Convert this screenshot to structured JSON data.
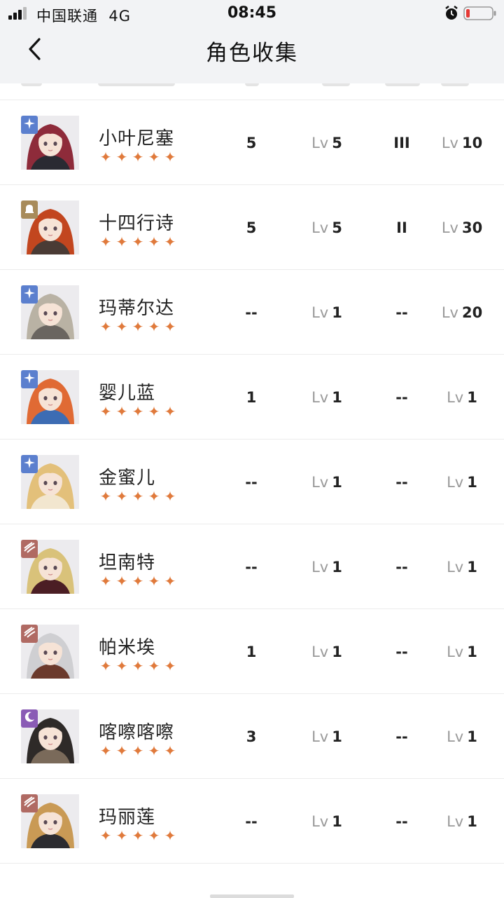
{
  "status": {
    "carrier": "中国联通",
    "network": "4G",
    "time": "08:45",
    "battery_color": "#e53935"
  },
  "nav": {
    "title": "角色收集"
  },
  "colors": {
    "star": "#e07a3c",
    "blue_badge": "#5b7fce",
    "gold_badge": "#a88b5a",
    "red_badge": "#b06a63",
    "purple_badge": "#8a5bb5"
  },
  "characters": [
    {
      "name": "小叶尼塞",
      "stars": "★★★★★",
      "badge": "star-icon",
      "badge_color": "#5b7fce",
      "col1": "5",
      "lv_label": "Lv",
      "col2": "5",
      "col3": "III",
      "col4": "10",
      "hair": "#8e2b3a",
      "coat": "#2a2a32"
    },
    {
      "name": "十四行诗",
      "stars": "★★★★★",
      "badge": "bell-icon",
      "badge_color": "#a88b5a",
      "col1": "5",
      "lv_label": "Lv",
      "col2": "5",
      "col3": "II",
      "col4": "30",
      "hair": "#c2461f",
      "coat": "#4a3b35"
    },
    {
      "name": "玛蒂尔达",
      "stars": "★★★★★",
      "badge": "star-icon",
      "badge_color": "#5b7fce",
      "col1": "--",
      "lv_label": "Lv",
      "col2": "1",
      "col3": "--",
      "col4": "20",
      "hair": "#b9b2a4",
      "coat": "#6a6560"
    },
    {
      "name": "婴儿蓝",
      "stars": "★★★★★",
      "badge": "star-icon",
      "badge_color": "#5b7fce",
      "col1": "1",
      "lv_label": "Lv",
      "col2": "1",
      "col3": "--",
      "col4": "1",
      "hair": "#e06a34",
      "coat": "#3d6cb3"
    },
    {
      "name": "金蜜儿",
      "stars": "★★★★★",
      "badge": "star-icon",
      "badge_color": "#5b7fce",
      "col1": "--",
      "lv_label": "Lv",
      "col2": "1",
      "col3": "--",
      "col4": "1",
      "hair": "#e3c07a",
      "coat": "#f2e6cf"
    },
    {
      "name": "坦南特",
      "stars": "★★★★★",
      "badge": "claw-icon",
      "badge_color": "#b06a63",
      "col1": "--",
      "lv_label": "Lv",
      "col2": "1",
      "col3": "--",
      "col4": "1",
      "hair": "#d9c27a",
      "coat": "#4b1e24"
    },
    {
      "name": "帕米埃",
      "stars": "★★★★★",
      "badge": "claw-icon",
      "badge_color": "#b06a63",
      "col1": "1",
      "lv_label": "Lv",
      "col2": "1",
      "col3": "--",
      "col4": "1",
      "hair": "#cfcfd2",
      "coat": "#6b3a2c"
    },
    {
      "name": "喀嚓喀嚓",
      "stars": "★★★★★",
      "badge": "moon-icon",
      "badge_color": "#8a5bb5",
      "col1": "3",
      "lv_label": "Lv",
      "col2": "1",
      "col3": "--",
      "col4": "1",
      "hair": "#2e2a28",
      "coat": "#7a6a5a"
    },
    {
      "name": "玛丽莲",
      "stars": "★★★★★",
      "badge": "claw-icon",
      "badge_color": "#b06a63",
      "col1": "--",
      "lv_label": "Lv",
      "col2": "1",
      "col3": "--",
      "col4": "1",
      "hair": "#c99a55",
      "coat": "#2c2c30"
    }
  ]
}
